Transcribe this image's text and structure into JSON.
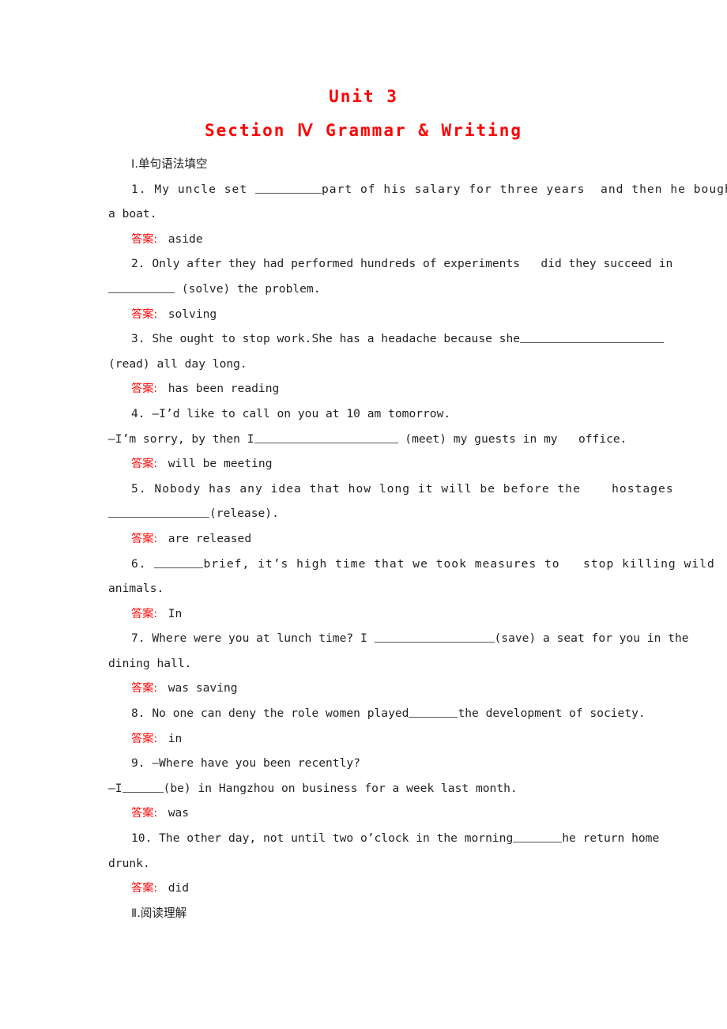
{
  "document": {
    "unit_title": "Unit 3",
    "section_title": "Section Ⅳ Grammar & Writing",
    "sections": [
      {
        "numeral": "Ⅰ",
        "heading": ".单句语法填空"
      },
      {
        "numeral": "Ⅱ",
        "heading": ".阅读理解"
      }
    ],
    "answer_label": "答案:",
    "questions": [
      {
        "number": "1.",
        "line1_a": " My uncle set ",
        "line1_b": "part of his salary for three years  and then he bought",
        "line2": "a boat.",
        "answer": "aside"
      },
      {
        "number": "2.",
        "line1": " Only after they had performed hundreds of experiments   did they succeed in",
        "line2_b": " (solve) the problem.",
        "answer": "solving"
      },
      {
        "number": "3.",
        "line1": " She ought to stop work.She has a headache because she",
        "line2": "(read) all day long.",
        "answer": "has been reading"
      },
      {
        "number": "4.",
        "line1": " —I’d like to call on you at 10 am tomorrow.",
        "line2_a": "—I’m sorry, by then I",
        "line2_b": " (meet) my guests in my   office.",
        "answer": "will be meeting"
      },
      {
        "number": "5.",
        "line1": " Nobody has any idea that how long it will be before the    hostages",
        "line2_b": "(release).",
        "answer": "are released"
      },
      {
        "number": "6.",
        "line1_a": " ",
        "line1_b": "brief, it’s high time that we took measures to   stop killing wild",
        "line2": "animals.",
        "answer": "In"
      },
      {
        "number": "7.",
        "line1_a": " Where were you at lunch time? I ",
        "line1_b": "(save) a seat for you in the",
        "line2": "dining hall.",
        "answer": "was saving"
      },
      {
        "number": "8.",
        "line1_a": " No one can deny the role women played",
        "line1_b": "the development of society.",
        "answer": "in"
      },
      {
        "number": "9.",
        "line1": " —Where have you been recently?",
        "line2_a": "—I",
        "line2_b": "(be) in Hangzhou on business for a week last month.",
        "answer": "was"
      },
      {
        "number": "10.",
        "line1_a": " The other day, not until two o’clock in the morning",
        "line1_b": "he return home",
        "line2": "drunk.",
        "answer": "did"
      }
    ]
  },
  "colors": {
    "accent_red": "#ff0000",
    "body_text": "#231f20",
    "blank_rule": "#55555a",
    "page_background": "#ffffff"
  }
}
